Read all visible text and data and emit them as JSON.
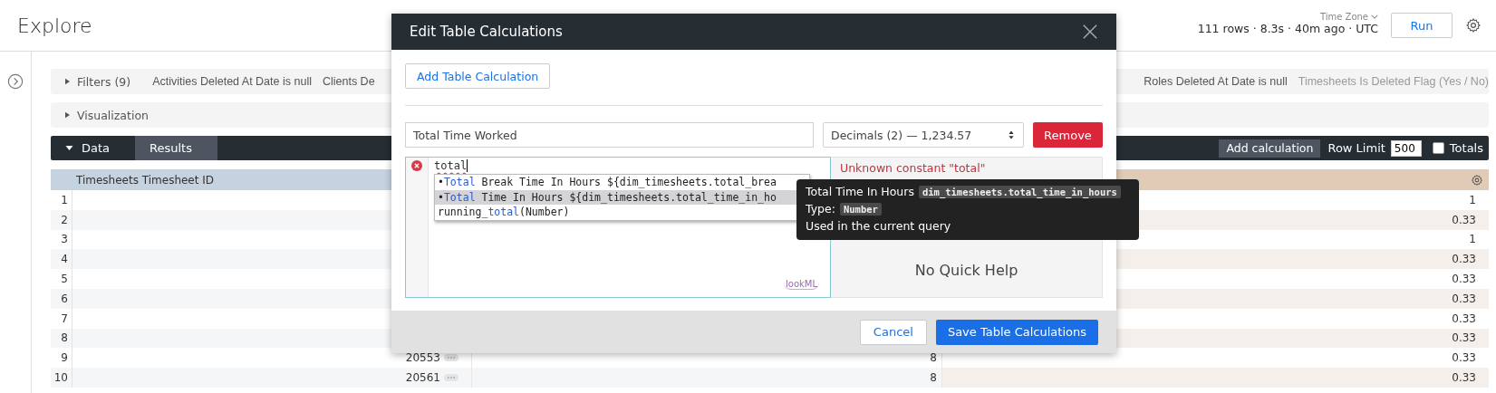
{
  "header": {
    "title": "Explore",
    "meta": "111 rows · 8.3s · 40m ago · UTC",
    "time_zone_label": "Time Zone",
    "run_button": "Run"
  },
  "filters": {
    "label": "Filters (9)",
    "expanded": false,
    "left_items": [
      "Activities Deleted At Date is null",
      "Clients De"
    ],
    "right_items": [
      "Roles Deleted At Date is null",
      "Timesheets Is Deleted Flag (Yes / No)"
    ]
  },
  "visualization": {
    "label": "Visualization",
    "expanded": false
  },
  "data_bar": {
    "tabs": [
      {
        "label": "Data",
        "selected": false,
        "expanded": true
      },
      {
        "label": "Results",
        "selected": true
      }
    ],
    "add_calculation": "Add calculation",
    "row_limit_label": "Row Limit",
    "row_limit": "500",
    "totals": {
      "label": "Totals",
      "checked": false
    }
  },
  "table": {
    "columns": [
      "Timesheets Timesheet ID"
    ],
    "rows": [
      {
        "number": "1",
        "column_4": "1"
      },
      {
        "number": "2",
        "column_4": "0.33"
      },
      {
        "number": "3",
        "column_4": "1"
      },
      {
        "number": "4",
        "column_4": "0.33"
      },
      {
        "number": "5",
        "column_4": "0.33"
      },
      {
        "number": "6",
        "column_4": "0.33"
      },
      {
        "number": "7",
        "column_4": "0.33"
      },
      {
        "number": "8",
        "column_4": "0.33"
      },
      {
        "number": "9",
        "timesheet_id": "20553",
        "column_3": "8",
        "column_4": "0.33"
      },
      {
        "number": "10",
        "timesheet_id": "20561",
        "column_3": "8",
        "column_4": "0.33"
      }
    ]
  },
  "modal": {
    "title": "Edit Table Calculations",
    "add_button": "Add Table Calculation",
    "name": "Total Time Worked",
    "format": "Decimals (2) — 1,234.57",
    "remove_button": "Remove",
    "code": "total",
    "error": true,
    "suggestions": [
      {
        "bullet": "•",
        "match": "Total",
        "after": " Break Time In Hours ${dim_timesheets.total_brea",
        "selected": false
      },
      {
        "bullet": "•",
        "match": "Total",
        "after": " Time In Hours ${dim_timesheets.total_time_in_ho",
        "selected": true
      },
      {
        "before": "running_",
        "match": "total",
        "after": "(Number)",
        "selected": false
      }
    ],
    "logo": "lookML",
    "help_error": "Unknown constant \"total\"",
    "help_text": "No Quick Help",
    "cancel_button": "Cancel",
    "save_button": "Save Table Calculations"
  },
  "tooltip": {
    "title": "Total Time In Hours",
    "field": "dim_timesheets.total_time_in_hours",
    "type_label": "Type:",
    "type": "Number",
    "note": "Used in the current query"
  }
}
